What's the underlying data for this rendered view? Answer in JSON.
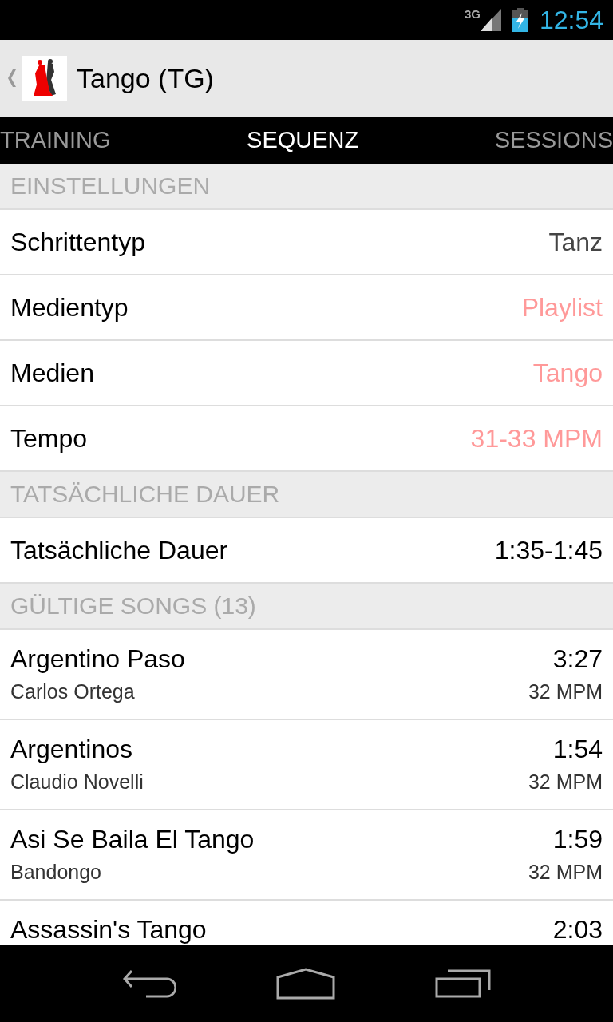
{
  "status_bar": {
    "network": "3G",
    "time": "12:54"
  },
  "app_bar": {
    "title": "Tango (TG)"
  },
  "tabs": [
    {
      "label": "TRAINING",
      "selected": false
    },
    {
      "label": "SEQUENZ",
      "selected": true
    },
    {
      "label": "SESSIONS",
      "selected": false
    }
  ],
  "sections": [
    {
      "header": "EINSTELLUNGEN",
      "rows": [
        {
          "label": "Schrittentyp",
          "value": "Tanz",
          "kind": "muted"
        },
        {
          "label": "Medientyp",
          "value": "Playlist",
          "kind": "link"
        },
        {
          "label": "Medien",
          "value": "Tango",
          "kind": "link"
        },
        {
          "label": "Tempo",
          "value": "31-33 MPM",
          "kind": "link"
        }
      ]
    },
    {
      "header": "TATSÄCHLICHE DAUER",
      "rows": [
        {
          "label": "Tatsächliche Dauer",
          "value": "1:35-1:45",
          "kind": "plain"
        }
      ]
    },
    {
      "header": "GÜLTIGE SONGS (13)",
      "songs": [
        {
          "title": "Argentino Paso",
          "duration": "3:27",
          "artist": "Carlos Ortega",
          "tempo": "32 MPM"
        },
        {
          "title": "Argentinos",
          "duration": "1:54",
          "artist": "Claudio Novelli",
          "tempo": "32 MPM"
        },
        {
          "title": "Asi Se Baila El Tango",
          "duration": "1:59",
          "artist": "Bandongo",
          "tempo": "32 MPM"
        },
        {
          "title": "Assassin's Tango",
          "duration": "2:03"
        }
      ]
    }
  ]
}
